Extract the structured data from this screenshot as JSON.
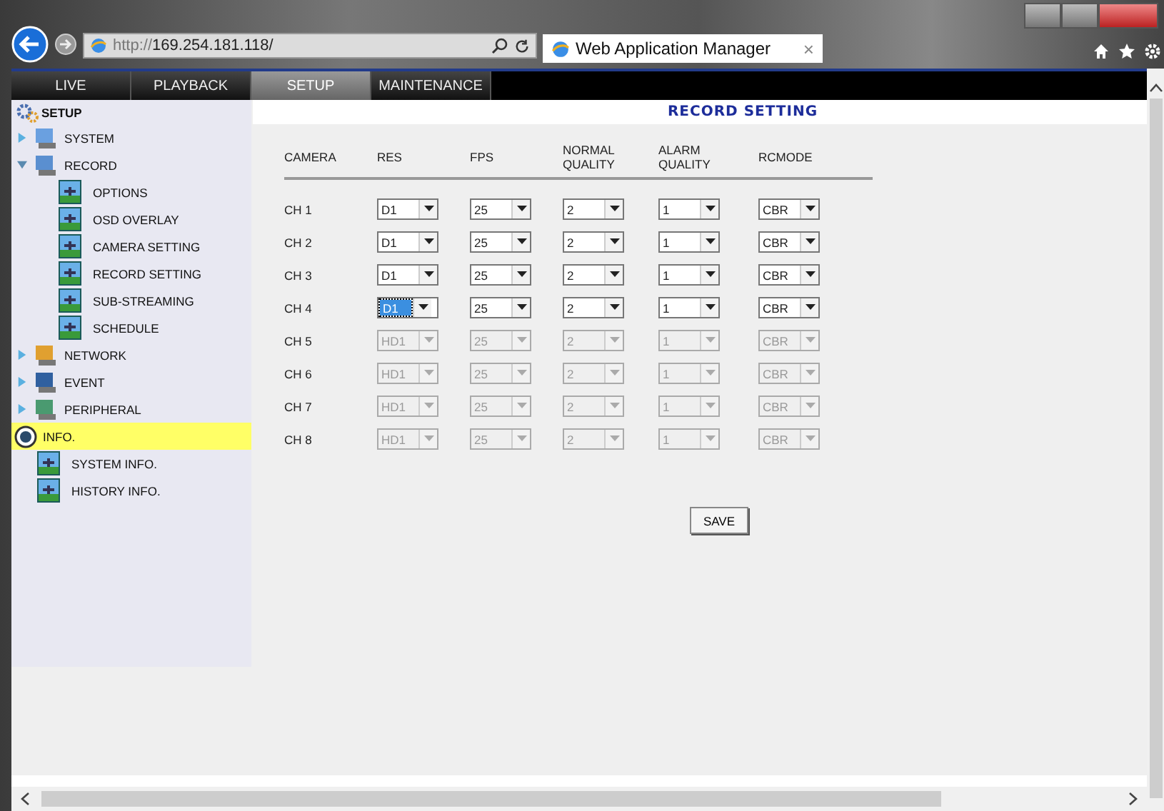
{
  "browser": {
    "url_scheme": "http://",
    "url_host": "169.254.181.118/",
    "tab_title": "Web Application Manager",
    "tab_close": "×"
  },
  "nav_tabs": [
    {
      "label": "LIVE",
      "selected": false
    },
    {
      "label": "PLAYBACK",
      "selected": false
    },
    {
      "label": "SETUP",
      "selected": true
    },
    {
      "label": "MAINTENANCE",
      "selected": false
    }
  ],
  "sidebar": {
    "title": "SETUP",
    "items": [
      {
        "label": "SYSTEM",
        "kind": "group",
        "expanded": false,
        "selected": false
      },
      {
        "label": "RECORD",
        "kind": "group",
        "expanded": true,
        "selected": false,
        "children": [
          {
            "label": "OPTIONS"
          },
          {
            "label": "OSD OVERLAY"
          },
          {
            "label": "CAMERA SETTING"
          },
          {
            "label": "RECORD SETTING"
          },
          {
            "label": "SUB-STREAMING"
          },
          {
            "label": "SCHEDULE"
          }
        ]
      },
      {
        "label": "NETWORK",
        "kind": "group",
        "expanded": false,
        "selected": false
      },
      {
        "label": "EVENT",
        "kind": "group",
        "expanded": false,
        "selected": false
      },
      {
        "label": "PERIPHERAL",
        "kind": "group",
        "expanded": false,
        "selected": false
      },
      {
        "label": "INFO.",
        "kind": "section",
        "expanded": true,
        "selected": true,
        "children": [
          {
            "label": "SYSTEM INFO."
          },
          {
            "label": "HISTORY INFO."
          }
        ]
      }
    ]
  },
  "page_title": "RECORD SETTING",
  "table": {
    "columns": [
      "CAMERA",
      "RES",
      "FPS",
      "NORMAL QUALITY",
      "ALARM QUALITY",
      "RCMODE"
    ],
    "rows": [
      {
        "disabled": false,
        "cells": [
          {
            "kind": "label",
            "value": "CH 1"
          },
          {
            "kind": "dropdown",
            "value": "D1",
            "focused": false
          },
          {
            "kind": "dropdown",
            "value": "25",
            "focused": false
          },
          {
            "kind": "dropdown",
            "value": "2",
            "focused": false
          },
          {
            "kind": "dropdown",
            "value": "1",
            "focused": false
          },
          {
            "kind": "dropdown",
            "value": "CBR",
            "focused": false
          }
        ]
      },
      {
        "disabled": false,
        "cells": [
          {
            "kind": "label",
            "value": "CH 2"
          },
          {
            "kind": "dropdown",
            "value": "D1",
            "focused": false
          },
          {
            "kind": "dropdown",
            "value": "25",
            "focused": false
          },
          {
            "kind": "dropdown",
            "value": "2",
            "focused": false
          },
          {
            "kind": "dropdown",
            "value": "1",
            "focused": false
          },
          {
            "kind": "dropdown",
            "value": "CBR",
            "focused": false
          }
        ]
      },
      {
        "disabled": false,
        "cells": [
          {
            "kind": "label",
            "value": "CH 3"
          },
          {
            "kind": "dropdown",
            "value": "D1",
            "focused": false
          },
          {
            "kind": "dropdown",
            "value": "25",
            "focused": false
          },
          {
            "kind": "dropdown",
            "value": "2",
            "focused": false
          },
          {
            "kind": "dropdown",
            "value": "1",
            "focused": false
          },
          {
            "kind": "dropdown",
            "value": "CBR",
            "focused": false
          }
        ]
      },
      {
        "disabled": false,
        "cells": [
          {
            "kind": "label",
            "value": "CH 4"
          },
          {
            "kind": "dropdown",
            "value": "D1",
            "focused": true
          },
          {
            "kind": "dropdown",
            "value": "25",
            "focused": false
          },
          {
            "kind": "dropdown",
            "value": "2",
            "focused": false
          },
          {
            "kind": "dropdown",
            "value": "1",
            "focused": false
          },
          {
            "kind": "dropdown",
            "value": "CBR",
            "focused": false
          }
        ]
      },
      {
        "disabled": true,
        "cells": [
          {
            "kind": "label",
            "value": "CH 5"
          },
          {
            "kind": "dropdown",
            "value": "HD1",
            "focused": false
          },
          {
            "kind": "dropdown",
            "value": "25",
            "focused": false
          },
          {
            "kind": "dropdown",
            "value": "2",
            "focused": false
          },
          {
            "kind": "dropdown",
            "value": "1",
            "focused": false
          },
          {
            "kind": "dropdown",
            "value": "CBR",
            "focused": false
          }
        ]
      },
      {
        "disabled": true,
        "cells": [
          {
            "kind": "label",
            "value": "CH 6"
          },
          {
            "kind": "dropdown",
            "value": "HD1",
            "focused": false
          },
          {
            "kind": "dropdown",
            "value": "25",
            "focused": false
          },
          {
            "kind": "dropdown",
            "value": "2",
            "focused": false
          },
          {
            "kind": "dropdown",
            "value": "1",
            "focused": false
          },
          {
            "kind": "dropdown",
            "value": "CBR",
            "focused": false
          }
        ]
      },
      {
        "disabled": true,
        "cells": [
          {
            "kind": "label",
            "value": "CH 7"
          },
          {
            "kind": "dropdown",
            "value": "HD1",
            "focused": false
          },
          {
            "kind": "dropdown",
            "value": "25",
            "focused": false
          },
          {
            "kind": "dropdown",
            "value": "2",
            "focused": false
          },
          {
            "kind": "dropdown",
            "value": "1",
            "focused": false
          },
          {
            "kind": "dropdown",
            "value": "CBR",
            "focused": false
          }
        ]
      },
      {
        "disabled": true,
        "cells": [
          {
            "kind": "label",
            "value": "CH 8"
          },
          {
            "kind": "dropdown",
            "value": "HD1",
            "focused": false
          },
          {
            "kind": "dropdown",
            "value": "25",
            "focused": false
          },
          {
            "kind": "dropdown",
            "value": "2",
            "focused": false
          },
          {
            "kind": "dropdown",
            "value": "1",
            "focused": false
          },
          {
            "kind": "dropdown",
            "value": "CBR",
            "focused": false
          }
        ]
      }
    ]
  },
  "save_button": "SAVE"
}
